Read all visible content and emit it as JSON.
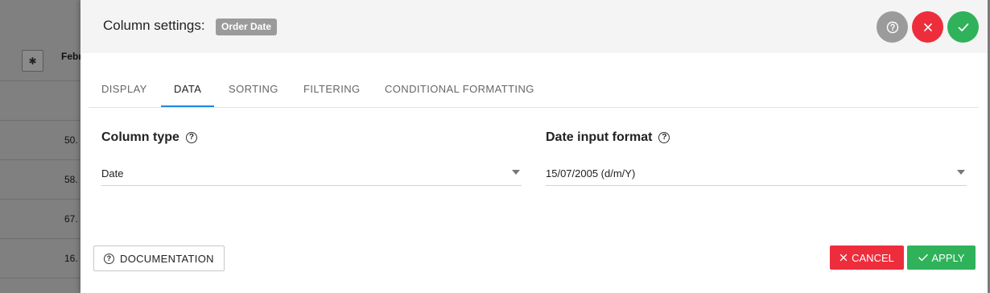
{
  "background": {
    "header_text": "Febr",
    "cells": [
      "50.",
      "58.",
      "67.",
      "16."
    ]
  },
  "modal": {
    "title": "Column settings:",
    "column_badge": "Order Date",
    "tabs": [
      {
        "label": "DISPLAY",
        "active": false
      },
      {
        "label": "DATA",
        "active": true
      },
      {
        "label": "SORTING",
        "active": false
      },
      {
        "label": "FILTERING",
        "active": false
      },
      {
        "label": "CONDITIONAL FORMATTING",
        "active": false
      }
    ],
    "column_type": {
      "label": "Column type",
      "value": "Date"
    },
    "date_input_format": {
      "label": "Date input format",
      "value": "15/07/2005 (d/m/Y)"
    },
    "buttons": {
      "documentation": "DOCUMENTATION",
      "cancel": "CANCEL",
      "apply": "APPLY"
    }
  },
  "colors": {
    "accent": "#1e88e5",
    "danger": "#ee2d3c",
    "success": "#2fb25a",
    "neutral": "#9b9b9b"
  },
  "icons": [
    "gear-icon",
    "help-icon",
    "close-icon",
    "check-icon",
    "caret-down-icon"
  ]
}
